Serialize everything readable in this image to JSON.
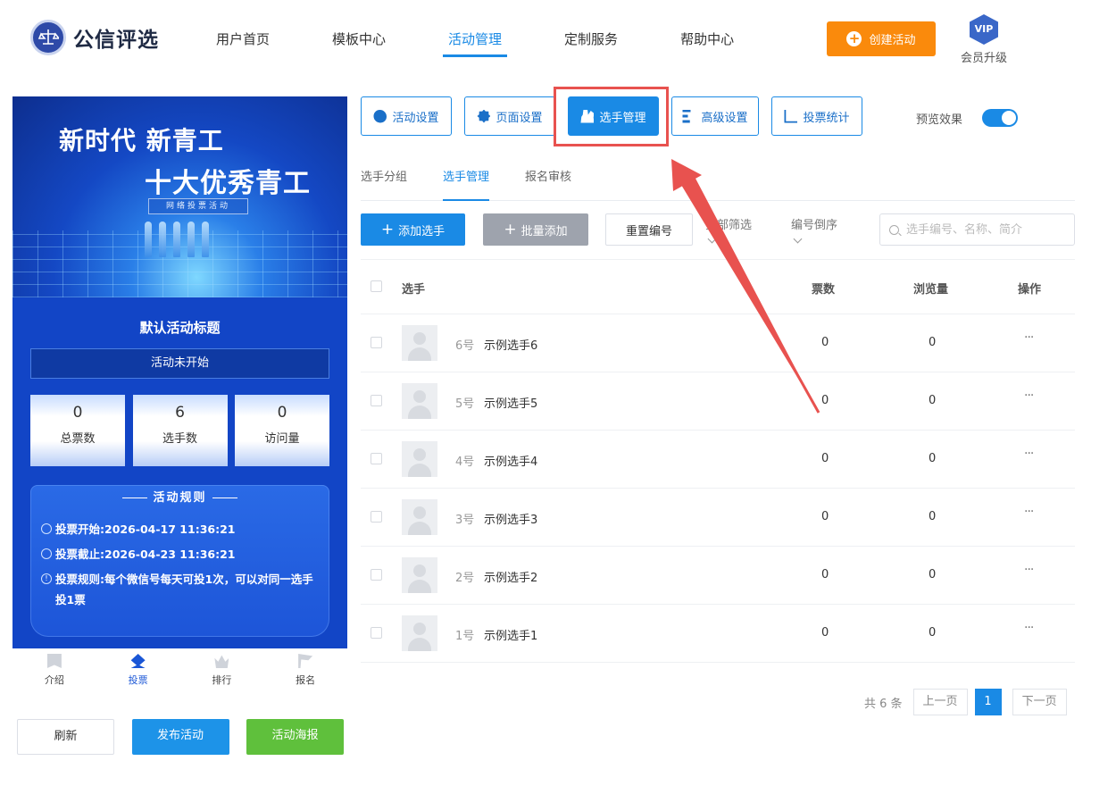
{
  "brand": {
    "name": "公信评选"
  },
  "nav": [
    {
      "label": "用户首页",
      "active": false
    },
    {
      "label": "模板中心",
      "active": false
    },
    {
      "label": "活动管理",
      "active": true
    },
    {
      "label": "定制服务",
      "active": false
    },
    {
      "label": "帮助中心",
      "active": false
    }
  ],
  "header": {
    "create_label": "创建活动",
    "vip_badge": "VIP",
    "vip_label": "会员升级",
    "accent_color": "#fa8a0c"
  },
  "preview": {
    "banner_line1": "新时代 新青工",
    "banner_line2": "十大优秀青工",
    "banner_tag": "网络投票活动",
    "title": "默认活动标题",
    "status": "活动未开始",
    "stats": [
      {
        "value": "0",
        "label": "总票数"
      },
      {
        "value": "6",
        "label": "选手数"
      },
      {
        "value": "0",
        "label": "访问量"
      }
    ],
    "rules_heading": "活动规则",
    "rules": [
      {
        "label": "投票开始:",
        "value": "2026-04-17 11:36:21"
      },
      {
        "label": "投票截止:",
        "value": "2026-04-23 11:36:21"
      },
      {
        "label": "投票规则:",
        "value": "每个微信号每天可投1次，可以对同一选手投1票"
      }
    ],
    "tabbar": [
      {
        "label": "介绍",
        "icon": "bookmark-icon",
        "active": false
      },
      {
        "label": "投票",
        "icon": "vote-icon",
        "active": true
      },
      {
        "label": "排行",
        "icon": "crown-icon",
        "active": false
      },
      {
        "label": "报名",
        "icon": "flag-icon",
        "active": false
      }
    ],
    "buttons": {
      "refresh": "刷新",
      "publish": "发布活动",
      "poster": "活动海报"
    }
  },
  "config_tabs": [
    {
      "label": "活动设置",
      "icon": "star-icon"
    },
    {
      "label": "页面设置",
      "icon": "gear-icon"
    },
    {
      "label": "选手管理",
      "icon": "users-icon",
      "active": true
    },
    {
      "label": "高级设置",
      "icon": "advanced-settings-icon"
    },
    {
      "label": "投票统计",
      "icon": "bar-chart-icon"
    }
  ],
  "preview_toggle": {
    "label": "预览效果",
    "on": true
  },
  "sub_tabs": [
    {
      "label": "选手分组",
      "active": false
    },
    {
      "label": "选手管理",
      "active": true
    },
    {
      "label": "报名审核",
      "active": false
    }
  ],
  "toolbar": {
    "add_label": "添加选手",
    "batch_label": "批量添加",
    "reset_label": "重置编号",
    "filter_label": "全部筛选",
    "order_label": "编号倒序",
    "search_placeholder": "选手编号、名称、简介"
  },
  "table": {
    "headers": {
      "player": "选手",
      "votes": "票数",
      "views": "浏览量",
      "ops": "操作"
    },
    "rows": [
      {
        "num": "6号",
        "name": "示例选手6",
        "votes": "0",
        "views": "0",
        "ops": "···"
      },
      {
        "num": "5号",
        "name": "示例选手5",
        "votes": "0",
        "views": "0",
        "ops": "···"
      },
      {
        "num": "4号",
        "name": "示例选手4",
        "votes": "0",
        "views": "0",
        "ops": "···"
      },
      {
        "num": "3号",
        "name": "示例选手3",
        "votes": "0",
        "views": "0",
        "ops": "···"
      },
      {
        "num": "2号",
        "name": "示例选手2",
        "votes": "0",
        "views": "0",
        "ops": "···"
      },
      {
        "num": "1号",
        "name": "示例选手1",
        "votes": "0",
        "views": "0",
        "ops": "···"
      }
    ]
  },
  "pagination": {
    "total": "共 6 条",
    "prev": "上一页",
    "current": "1",
    "next": "下一页"
  },
  "annotation": {
    "color": "#e8524f"
  }
}
